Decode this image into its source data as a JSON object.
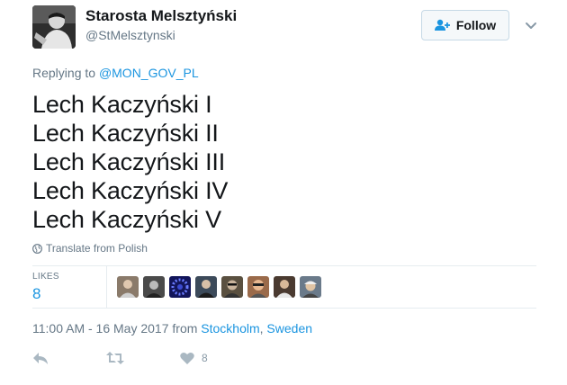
{
  "author": {
    "display_name": "Starosta Melsztyński",
    "handle": "@StMelsztynski",
    "avatar_icon": "profile-photo"
  },
  "follow_button": {
    "label": "Follow",
    "icon": "add-user-icon"
  },
  "menu_icon": "chevron-down-icon",
  "reply_context": {
    "prefix": "Replying to",
    "mention": "@MON_GOV_PL"
  },
  "tweet": {
    "lines": [
      "Lech Kaczyński I",
      "Lech Kaczyński II",
      "Lech Kaczyński III",
      "Lech Kaczyński IV",
      "Lech Kaczyński V"
    ]
  },
  "translate": {
    "label": "Translate from Polish",
    "icon": "globe-icon"
  },
  "stats": {
    "likes_label": "LIKES",
    "likes_count": "8"
  },
  "likers": [
    {
      "icon": "liker-avatar",
      "color": "#8a7a6a"
    },
    {
      "icon": "liker-avatar",
      "color": "#4a4a4a"
    },
    {
      "icon": "liker-avatar",
      "color": "#2b2f8a"
    },
    {
      "icon": "liker-avatar",
      "color": "#3c4a5a"
    },
    {
      "icon": "liker-avatar",
      "color": "#5a5040"
    },
    {
      "icon": "liker-avatar",
      "color": "#9a6a4a"
    },
    {
      "icon": "liker-avatar",
      "color": "#4a3a30"
    },
    {
      "icon": "liker-avatar",
      "color": "#6a7a8a"
    }
  ],
  "timestamp": {
    "time_date": "11:00 AM - 16 May 2017",
    "from": "from",
    "location_city": "Stockholm",
    "location_sep": ", ",
    "location_country": "Sweden"
  },
  "actions": {
    "reply_icon": "reply-icon",
    "retweet_icon": "retweet-icon",
    "like_icon": "heart-icon",
    "like_count": "8"
  },
  "colors": {
    "link": "#1b95e0",
    "secondary_text": "#657786",
    "primary_text": "#14171a"
  }
}
